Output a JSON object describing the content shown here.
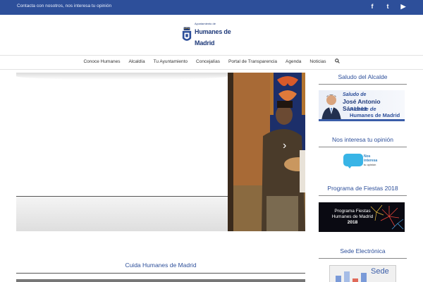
{
  "topbar": {
    "message": "Contacta con nosotros, nos interesa tu opinión",
    "social": [
      {
        "icon": "facebook-icon",
        "glyph": "f"
      },
      {
        "icon": "twitter-icon",
        "glyph": "t"
      },
      {
        "icon": "youtube-icon",
        "glyph": "▶"
      }
    ]
  },
  "logo": {
    "line1": "Ayuntamiento de",
    "line2": "Humanes de Madrid",
    "icon": "crest-icon"
  },
  "nav": {
    "items": [
      "Conoce Humanes",
      "Alcaldía",
      "Tu Ayuntamiento",
      "Concejalías",
      "Portal de Transparencia",
      "Agenda",
      "Noticias"
    ],
    "search_icon": "search-icon"
  },
  "slider": {
    "next_icon": "chevron-right-icon",
    "next_glyph": "›"
  },
  "main": {
    "section_title": "Cuida Humanes de Madrid"
  },
  "sidebar": {
    "saludo": {
      "title": "Saludo del Alcalde",
      "banner_l1": "Saludo de",
      "banner_l2": "José Antonio Sánchez",
      "banner_l3": "Alcalde de",
      "banner_l4": "Humanes de Madrid"
    },
    "opinion": {
      "title": "Nos interesa tu opinión",
      "bubble_l1": "Nos",
      "bubble_l2": "interesa",
      "bubble_l3": "tu opinión"
    },
    "fiestas": {
      "title": "Programa de Fiestas 2018",
      "l1": "Programa Fiestas",
      "l2": "Humanes de Madrid",
      "l3": "2018"
    },
    "sede": {
      "title": "Sede Electrónica",
      "label": "Sede"
    }
  },
  "colors": {
    "brand_blue": "#2d4f9a",
    "topbar_bg": "#2d4f9a",
    "bubble": "#38b4e6"
  }
}
